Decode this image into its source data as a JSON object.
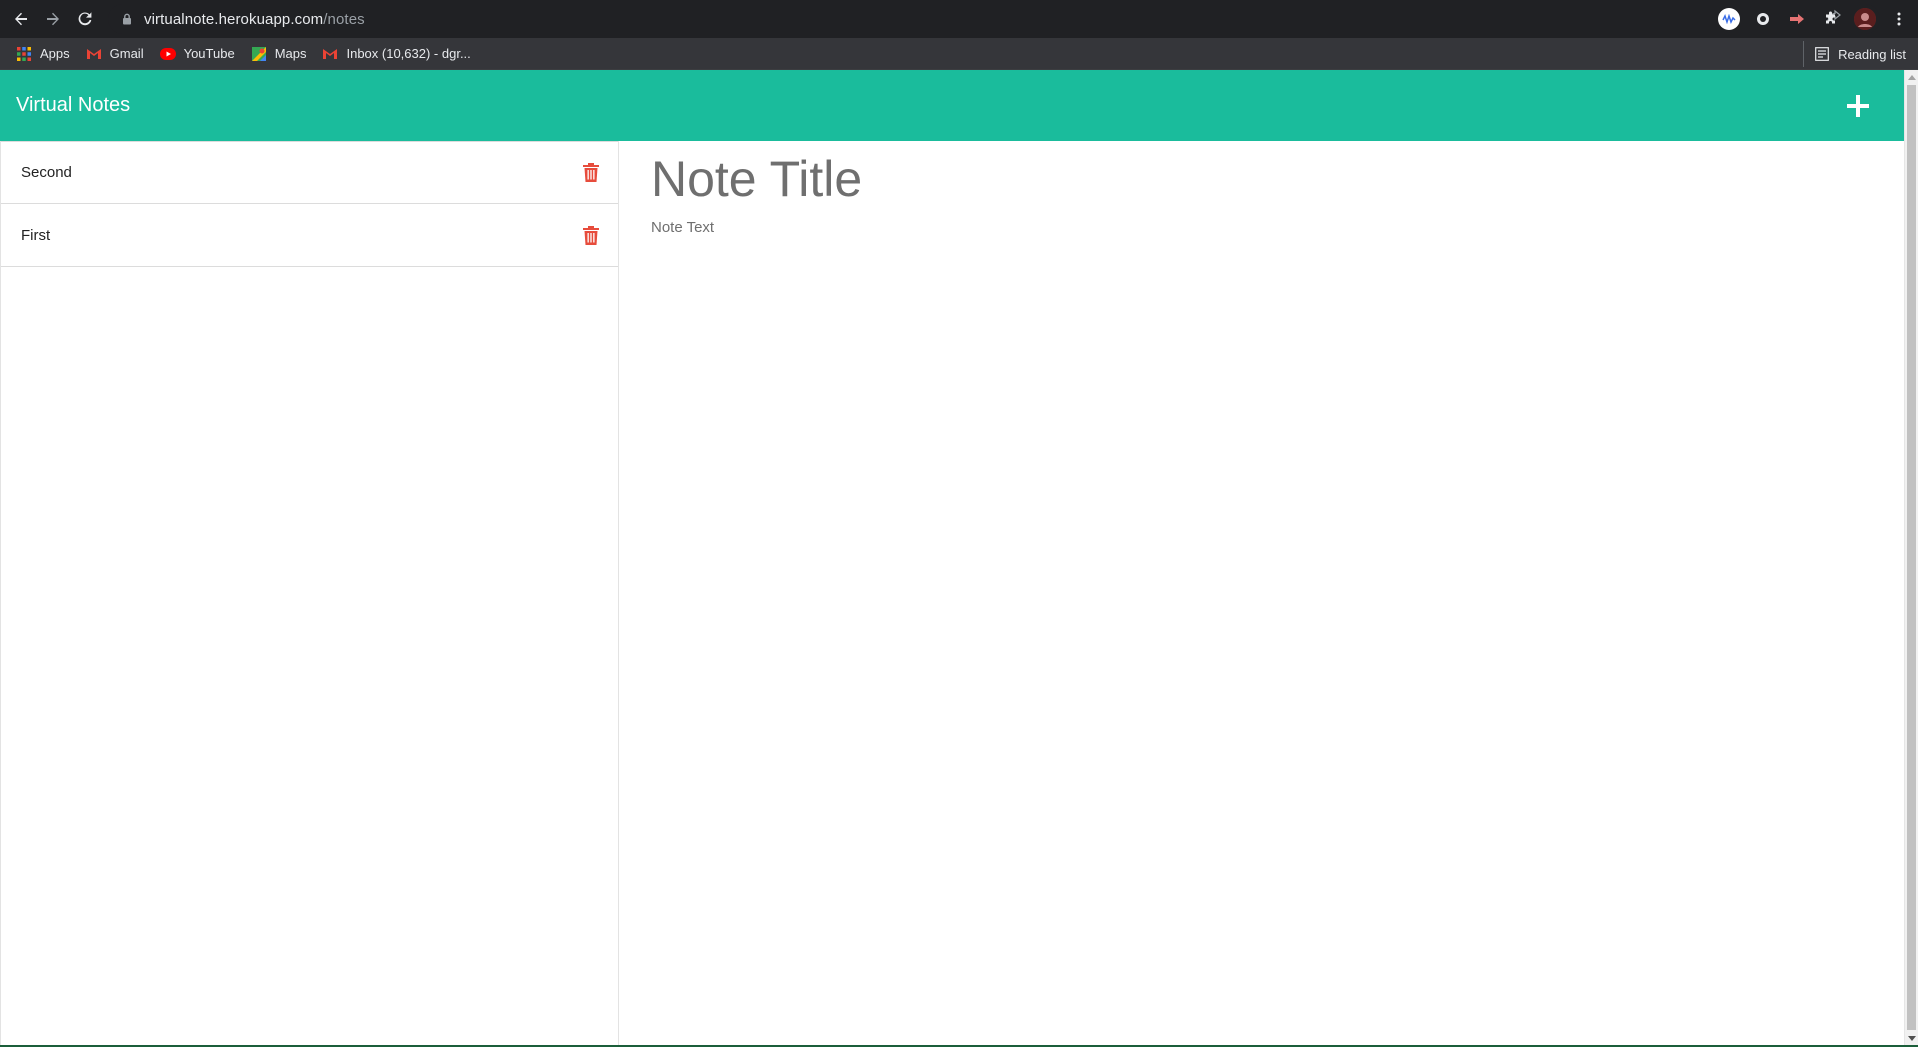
{
  "browser": {
    "url_host": "virtualnote.herokuapp.com",
    "url_path": "/notes",
    "bookmarks": [
      {
        "label": "Apps",
        "icon": "apps-grid-icon"
      },
      {
        "label": "Gmail",
        "icon": "gmail-icon"
      },
      {
        "label": "YouTube",
        "icon": "youtube-icon"
      },
      {
        "label": "Maps",
        "icon": "maps-icon"
      },
      {
        "label": "Inbox (10,632) - dgr...",
        "icon": "gmail-icon"
      }
    ],
    "reading_list_label": "Reading list"
  },
  "app": {
    "title": "Virtual Notes",
    "accent_color": "#1abc9c",
    "delete_color": "#e74c3c"
  },
  "notes": [
    {
      "title": "Second"
    },
    {
      "title": "First"
    }
  ],
  "editor": {
    "title_placeholder": "Note Title",
    "text_placeholder": "Note Text"
  }
}
